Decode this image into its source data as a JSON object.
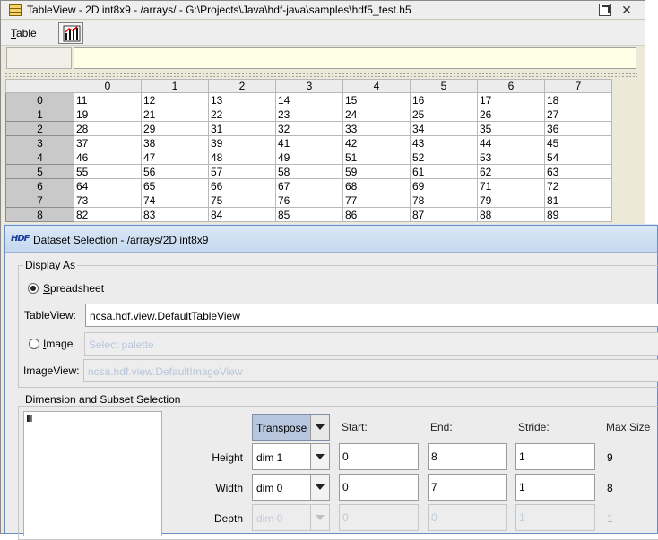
{
  "table_window": {
    "title": "TableView  -  2D int8x9  -  /arrays/  -  G:\\Projects\\Java\\hdf-java\\samples\\hdf5_test.h5",
    "menu_table": "Table",
    "close_glyph": "✕",
    "cell_label": "",
    "cell_value": ""
  },
  "grid": {
    "columns": [
      "0",
      "1",
      "2",
      "3",
      "4",
      "5",
      "6",
      "7"
    ],
    "rows": [
      {
        "label": "0",
        "cells": [
          "11",
          "12",
          "13",
          "14",
          "15",
          "16",
          "17",
          "18"
        ]
      },
      {
        "label": "1",
        "cells": [
          "19",
          "21",
          "22",
          "23",
          "24",
          "25",
          "26",
          "27"
        ]
      },
      {
        "label": "2",
        "cells": [
          "28",
          "29",
          "31",
          "32",
          "33",
          "34",
          "35",
          "36"
        ]
      },
      {
        "label": "3",
        "cells": [
          "37",
          "38",
          "39",
          "41",
          "42",
          "43",
          "44",
          "45"
        ]
      },
      {
        "label": "4",
        "cells": [
          "46",
          "47",
          "48",
          "49",
          "51",
          "52",
          "53",
          "54"
        ]
      },
      {
        "label": "5",
        "cells": [
          "55",
          "56",
          "57",
          "58",
          "59",
          "61",
          "62",
          "63"
        ]
      },
      {
        "label": "6",
        "cells": [
          "64",
          "65",
          "66",
          "67",
          "68",
          "69",
          "71",
          "72"
        ]
      },
      {
        "label": "7",
        "cells": [
          "73",
          "74",
          "75",
          "76",
          "77",
          "78",
          "79",
          "81"
        ]
      },
      {
        "label": "8",
        "cells": [
          "82",
          "83",
          "84",
          "85",
          "86",
          "87",
          "88",
          "89"
        ]
      }
    ]
  },
  "dialog": {
    "icon_text": "HDF",
    "title": "Dataset Selection - /arrays/2D int8x9",
    "display_as": {
      "legend": "Display As",
      "spreadsheet_label": "Spreadsheet",
      "spreadsheet_selected": true,
      "tableview_label": "TableView:",
      "tableview_value": "ncsa.hdf.view.DefaultTableView",
      "image_label": "Image",
      "image_selected": false,
      "palette_placeholder": "Select palette",
      "imageview_label": "ImageView:",
      "imageview_value": "ncsa.hdf.view.DefaultImageView"
    },
    "subset": {
      "legend": "Dimension and Subset Selection",
      "transpose_label": "Transpose",
      "headers": {
        "start": "Start:",
        "end": "End:",
        "stride": "Stride:",
        "max": "Max Size"
      },
      "rows": [
        {
          "label": "Height",
          "dim": "dim 1",
          "start": "0",
          "end": "8",
          "stride": "1",
          "max": "9",
          "enabled": true
        },
        {
          "label": "Width",
          "dim": "dim 0",
          "start": "0",
          "end": "7",
          "stride": "1",
          "max": "8",
          "enabled": true
        },
        {
          "label": "Depth",
          "dim": "dim 0",
          "start": "0",
          "end": "0",
          "stride": "1",
          "max": "1",
          "enabled": false
        }
      ]
    }
  },
  "colors": {
    "window_bg": "#ece9d8",
    "dialog_title_bg": "#c5d8ee",
    "row_header_bg": "#c9c9c9",
    "cell_value_bg": "#ffffe5",
    "transpose_bg": "#b8c7de"
  },
  "icons": [
    "table-app-icon",
    "maximize-icon",
    "close-icon",
    "chart-icon",
    "hdf-icon",
    "dropdown-arrow-icon"
  ]
}
